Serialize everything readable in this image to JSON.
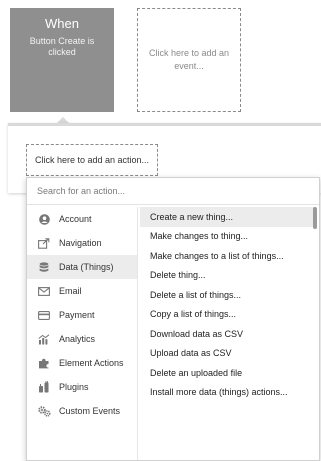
{
  "when_card": {
    "title": "When",
    "description": "Button Create is clicked"
  },
  "event_card": {
    "label": "Click here to add an event..."
  },
  "action_panel": {
    "add_action_label": "Click here to add an action..."
  },
  "search": {
    "placeholder": "Search for an action..."
  },
  "categories": [
    {
      "label": "Account",
      "icon": "account-icon"
    },
    {
      "label": "Navigation",
      "icon": "navigation-icon"
    },
    {
      "label": "Data (Things)",
      "icon": "database-icon",
      "selected": true
    },
    {
      "label": "Email",
      "icon": "email-icon"
    },
    {
      "label": "Payment",
      "icon": "credit-card-icon"
    },
    {
      "label": "Analytics",
      "icon": "analytics-icon"
    },
    {
      "label": "Element Actions",
      "icon": "element-actions-icon"
    },
    {
      "label": "Plugins",
      "icon": "plugins-icon"
    },
    {
      "label": "Custom Events",
      "icon": "gears-icon"
    }
  ],
  "actions": [
    {
      "label": "Create a new thing...",
      "highlighted": true
    },
    {
      "label": "Make changes to thing..."
    },
    {
      "label": "Make changes to a list of things..."
    },
    {
      "label": "Delete thing..."
    },
    {
      "label": "Delete a list of things..."
    },
    {
      "label": "Copy a list of things..."
    },
    {
      "label": "Download data as CSV"
    },
    {
      "label": "Upload data as CSV"
    },
    {
      "label": "Delete an uploaded file"
    },
    {
      "label": "Install more data (things) actions..."
    }
  ],
  "colors": {
    "when_card_bg": "#8f8f8f",
    "selected_row_bg": "#ececec",
    "icon_gray": "#777777"
  }
}
